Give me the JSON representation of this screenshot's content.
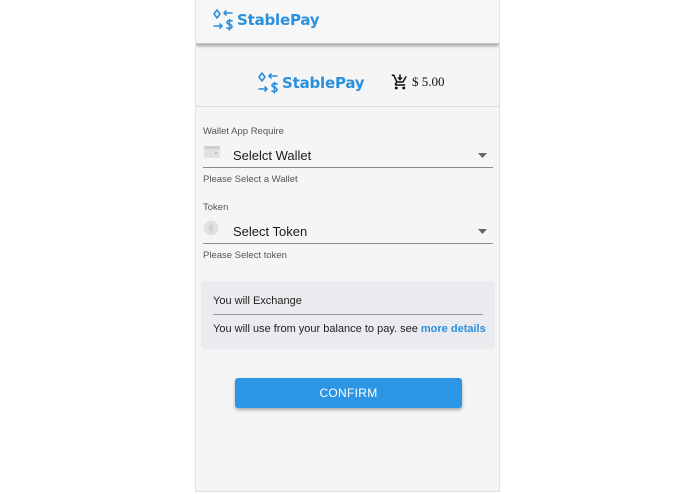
{
  "app": {
    "brand_name": "StablePay",
    "brand_color": "#2a8fdc"
  },
  "header": {
    "brand_name": "StablePay",
    "cart_icon": "cart-icon",
    "price": "$ 5.00"
  },
  "form": {
    "wallet": {
      "label": "Wallet App Require",
      "icon": "wallet-icon",
      "selected": "Selelct Wallet",
      "helper": "Please Select a Wallet"
    },
    "token": {
      "label": "Token",
      "icon": "token-icon",
      "selected": "Select Token",
      "helper": "Please Select token"
    }
  },
  "exchange_info": {
    "title": "You will Exchange",
    "text": "You will use from your balance to pay. see",
    "link": "more details"
  },
  "actions": {
    "confirm_label": "CONFIRM",
    "confirm_color": "#2d96e4"
  }
}
